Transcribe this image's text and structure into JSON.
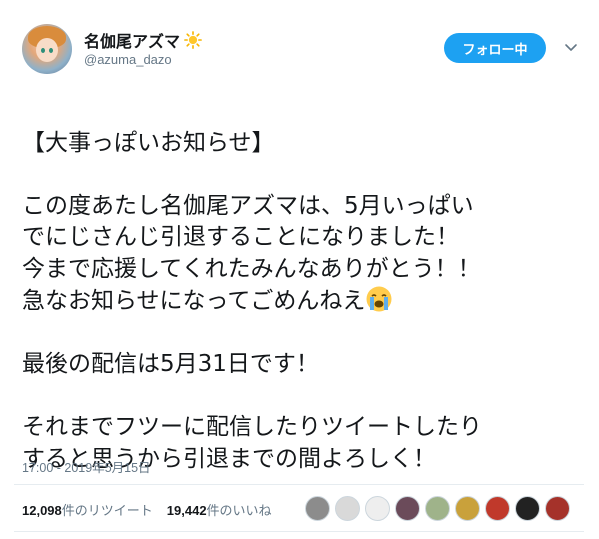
{
  "user": {
    "display_name": "名伽尾アズマ",
    "name_emoji": "sun",
    "handle": "@azuma_dazo"
  },
  "follow_button": {
    "label": "フォロー中"
  },
  "tweet": {
    "lines": [
      "【大事っぽいお知らせ】",
      "",
      "この度あたし名伽尾アズマは、5月いっぱい",
      "でにじさんじ引退することになりました！",
      "今まで応援してくれたみんなありがとう！！",
      "急なお知らせになってごめんねえ",
      "",
      "最後の配信は5月31日です！",
      "",
      "それまでフツーに配信したりツイートしたり",
      "すると思うから引退までの間よろしく！"
    ],
    "emoji": "loudly-crying-face"
  },
  "timestamp": "17:00 - 2019年5月15日",
  "stats": {
    "retweets_count": "12,098",
    "retweets_label": "件のリツイート",
    "likes_count": "19,442",
    "likes_label": "件のいいね"
  },
  "likers": [
    "#8c8c8c",
    "#d9d9d9",
    "#eeeeee",
    "#6b4b5a",
    "#9fb38a",
    "#c9a13b",
    "#c0392b",
    "#222222",
    "#a5322a"
  ],
  "colors": {
    "accent": "#1da1f2",
    "text": "#14171a",
    "muted": "#657786"
  }
}
